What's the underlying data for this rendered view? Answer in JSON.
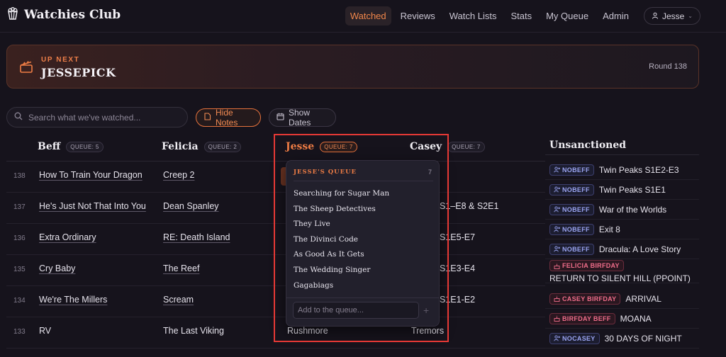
{
  "app": {
    "name": "Watchies Club"
  },
  "nav": {
    "links": [
      "Watched",
      "Reviews",
      "Watch Lists",
      "Stats",
      "My Queue",
      "Admin"
    ],
    "active": "Watched",
    "user": "Jesse"
  },
  "upnext": {
    "eyebrow": "UP NEXT",
    "title": "JESSEPICK",
    "round": "Round 138"
  },
  "controls": {
    "search_placeholder": "Search what we've watched...",
    "hide_notes": "Hide Notes",
    "show_dates": "Show Dates"
  },
  "columns": [
    {
      "name": "Beff",
      "queue": "QUEUE: 5"
    },
    {
      "name": "Felicia",
      "queue": "QUEUE: 2"
    },
    {
      "name": "Jesse",
      "queue": "QUEUE: 7"
    },
    {
      "name": "Casey",
      "queue": "QUEUE: 7"
    }
  ],
  "rows": [
    {
      "num": "138",
      "beff": "How To Train Your Dragon",
      "felicia": "Creep 2",
      "jesse": "",
      "casey": ""
    },
    {
      "num": "137",
      "beff": "He's Just Not That Into You",
      "felicia": "Dean Spanley",
      "jesse": "",
      "casey": "S1–E8 & S2E1"
    },
    {
      "num": "136",
      "beff": "Extra Ordinary",
      "felicia": "RE: Death Island",
      "jesse": "",
      "casey": "S1E5-E7"
    },
    {
      "num": "135",
      "beff": "Cry Baby",
      "felicia": "The Reef",
      "jesse": "",
      "casey": "S1E3-E4"
    },
    {
      "num": "134",
      "beff": "We're The Millers",
      "felicia": "Scream",
      "jesse": "",
      "casey": "S1E1-E2"
    },
    {
      "num": "133",
      "beff": "RV",
      "felicia": "The Last Viking",
      "jesse": "Rushmore",
      "casey": "Tremors"
    }
  ],
  "unsanctioned": {
    "title": "Unsanctioned",
    "items": [
      {
        "tag": "NOBEFF",
        "kind": "nob",
        "text": "Twin Peaks S1E2-E3"
      },
      {
        "tag": "NOBEFF",
        "kind": "nob",
        "text": "Twin Peaks S1E1"
      },
      {
        "tag": "NOBEFF",
        "kind": "nob",
        "text": "War of the Worlds"
      },
      {
        "tag": "NOBEFF",
        "kind": "nob",
        "text": "Exit 8"
      },
      {
        "tag": "NOBEFF",
        "kind": "nob",
        "text": "Dracula: A Love Story"
      },
      {
        "tag": "FELICIA BIRFDAY",
        "kind": "bd",
        "text": "RETURN TO SILENT HILL (PPOINT)"
      },
      {
        "tag": "CASEY BIRFDAY",
        "kind": "bd",
        "text": "ARRIVAL"
      },
      {
        "tag": "BIRFDAY BEFF",
        "kind": "bd",
        "text": "MOANA"
      },
      {
        "tag": "NOCASEY",
        "kind": "nob",
        "text": "30 DAYS OF NIGHT"
      }
    ]
  },
  "queue_popover": {
    "title": "JESSE'S QUEUE",
    "count": "7",
    "items": [
      "Searching for Sugar Man",
      "The Sheep Detectives",
      "They Live",
      "The Divinci Code",
      "As Good As It Gets",
      "The Wedding Singer",
      "Gagabiags"
    ],
    "input_placeholder": "Add to the queue...",
    "add": "+"
  },
  "colors": {
    "accent": "#ef7d45",
    "background": "#16131c",
    "highlight": "#e53935"
  },
  "icons": [
    "popcorn-icon",
    "user-icon",
    "clapperboard-icon",
    "search-icon",
    "note-icon",
    "calendar-icon"
  ]
}
